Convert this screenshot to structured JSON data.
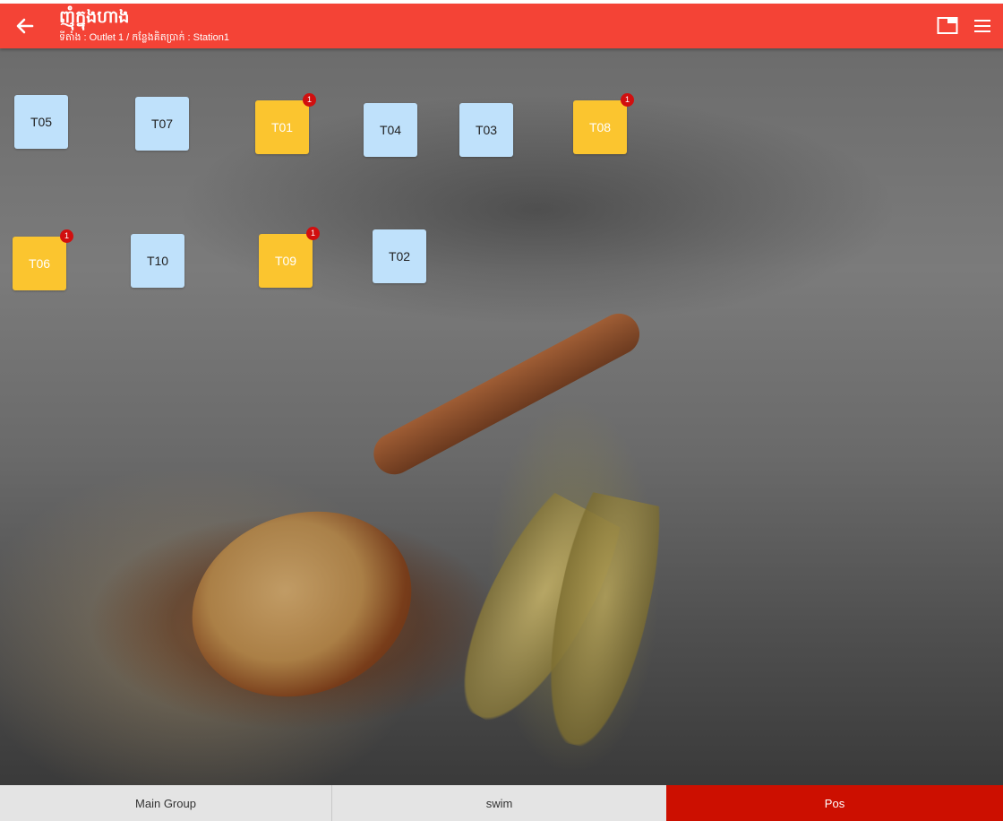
{
  "header": {
    "title": "ញុំក្នុងហាង",
    "subtitle": "ទីតាំង : Outlet 1 / កន្លែងគិតប្រាក់ : Station1",
    "accent_color": "#f44336",
    "icons": {
      "back": "arrow-left-icon",
      "window": "window-icon",
      "menu": "hamburger-menu-icon"
    }
  },
  "tables": [
    {
      "label": "T05",
      "status": "free"
    },
    {
      "label": "T07",
      "status": "free"
    },
    {
      "label": "T01",
      "status": "occupied",
      "badge": "1"
    },
    {
      "label": "T04",
      "status": "free"
    },
    {
      "label": "T03",
      "status": "free"
    },
    {
      "label": "T08",
      "status": "occupied",
      "badge": "1"
    },
    {
      "label": "T06",
      "status": "occupied",
      "badge": "1"
    },
    {
      "label": "T10",
      "status": "free"
    },
    {
      "label": "T09",
      "status": "occupied",
      "badge": "1"
    },
    {
      "label": "T02",
      "status": "free"
    }
  ],
  "colors": {
    "free_table": "#bfe1fb",
    "occupied_table": "#fbc52f",
    "badge": "#d10f0f",
    "active_tab": "#cc0f00"
  },
  "bottom_tabs": [
    {
      "label": "Main Group",
      "active": false
    },
    {
      "label": "swim",
      "active": false
    },
    {
      "label": "Pos",
      "active": true
    }
  ]
}
